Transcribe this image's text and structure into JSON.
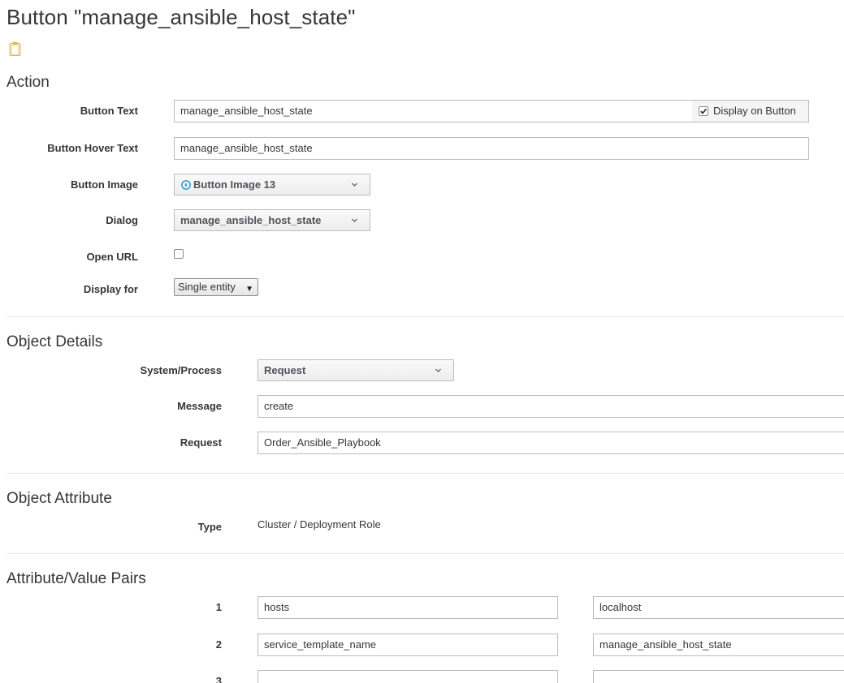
{
  "page": {
    "title": "Button \"manage_ansible_host_state\""
  },
  "icons": {
    "clipboard": "clipboard-icon",
    "button_image": "lightning-circle-icon",
    "chevron": "chevron-down-icon",
    "check": "check-icon"
  },
  "action": {
    "section_title": "Action",
    "button_text": {
      "label": "Button Text",
      "value": "manage_ansible_host_state",
      "display_on_button_label": "Display on Button",
      "display_on_button_checked": true
    },
    "hover_text": {
      "label": "Button Hover Text",
      "value": "manage_ansible_host_state"
    },
    "button_image": {
      "label": "Button Image",
      "value": "Button Image 13"
    },
    "dialog": {
      "label": "Dialog",
      "value": "manage_ansible_host_state"
    },
    "open_url": {
      "label": "Open URL",
      "checked": false
    },
    "display_for": {
      "label": "Display for",
      "value": "Single entity"
    }
  },
  "object_details": {
    "section_title": "Object Details",
    "system_process": {
      "label": "System/Process",
      "value": "Request"
    },
    "message": {
      "label": "Message",
      "value": "create"
    },
    "request": {
      "label": "Request",
      "value": "Order_Ansible_Playbook"
    }
  },
  "object_attribute": {
    "section_title": "Object Attribute",
    "type": {
      "label": "Type",
      "value": "Cluster / Deployment Role"
    }
  },
  "attribute_value_pairs": {
    "section_title": "Attribute/Value Pairs",
    "rows": [
      {
        "index": "1",
        "attribute": "hosts",
        "value": "localhost"
      },
      {
        "index": "2",
        "attribute": "service_template_name",
        "value": "manage_ansible_host_state"
      },
      {
        "index": "3",
        "attribute": "",
        "value": ""
      }
    ]
  },
  "colors": {
    "text": "#363636",
    "border": "#bbbbbb",
    "divider": "#e7e7e7",
    "icon_blue": "#0088ce",
    "clipboard_gold": "#f0c674"
  }
}
